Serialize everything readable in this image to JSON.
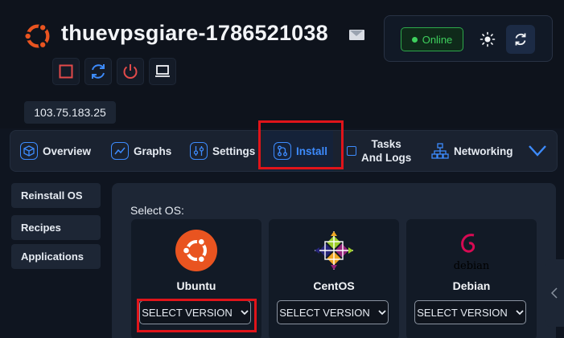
{
  "header": {
    "title": "thuevpsgiare-1786521038",
    "status_label": "Online",
    "ip": "103.75.183.25"
  },
  "controls": [
    "stop-icon",
    "restart-icon",
    "power-icon",
    "console-icon"
  ],
  "nav": {
    "overview": "Overview",
    "graphs": "Graphs",
    "settings": "Settings",
    "install": "Install",
    "tasks_line1": "Tasks",
    "tasks_line2": "And Logs",
    "networking": "Networking"
  },
  "sidebar": {
    "items": [
      {
        "label": "Reinstall OS"
      },
      {
        "label": "Recipes"
      },
      {
        "label": "Applications"
      }
    ]
  },
  "main": {
    "select_os_label": "Select OS:",
    "os_cards": [
      {
        "name": "Ubuntu",
        "button": "SELECT VERSION"
      },
      {
        "name": "CentOS",
        "button": "SELECT VERSION"
      },
      {
        "name": "Debian",
        "button": "SELECT VERSION",
        "logo_text": "debian"
      }
    ]
  },
  "colors": {
    "accent": "#3d8bfd",
    "online": "#3ecf5d",
    "highlight": "#e0141a",
    "ubuntu": "#e95420",
    "debian": "#d70a53"
  }
}
